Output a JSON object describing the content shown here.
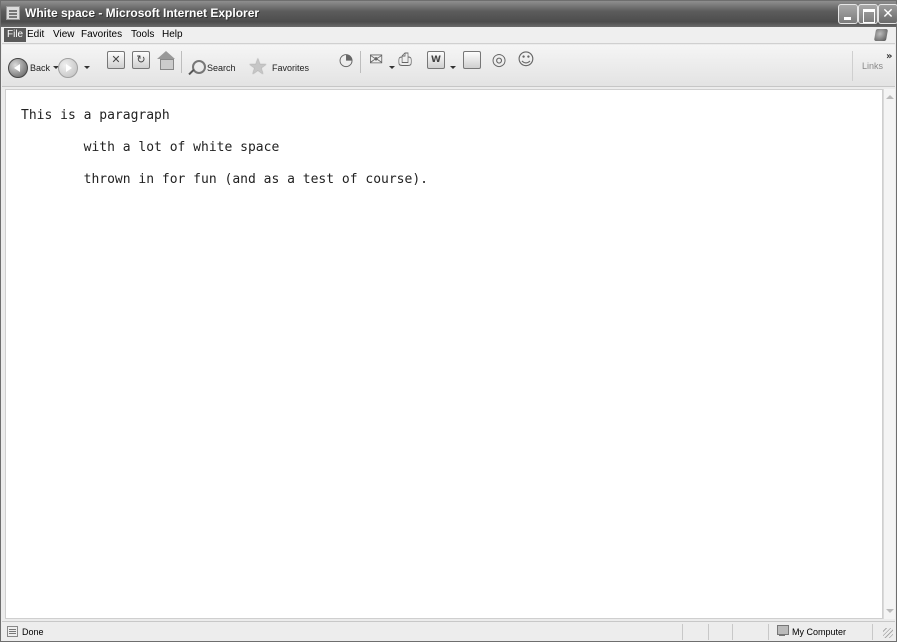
{
  "window": {
    "title": "White space - Microsoft Internet Explorer",
    "controls": {
      "close_glyph": "✕"
    }
  },
  "menubar": {
    "items": [
      "File",
      "Edit",
      "View",
      "Favorites",
      "Tools",
      "Help"
    ]
  },
  "toolbar": {
    "back_label": "Back",
    "search_label": "Search",
    "favorites_label": "Favorites",
    "links_label": "Links",
    "chevron": "»",
    "icons": {
      "back": "back-arrow-icon",
      "forward": "forward-arrow-icon",
      "stop": "stop-icon",
      "refresh": "refresh-icon",
      "home": "home-icon",
      "search": "search-icon",
      "favorites": "favorites-star-icon",
      "history": "history-icon",
      "mail": "mail-icon",
      "print": "print-icon",
      "edit": "edit-word-icon",
      "discuss": "discuss-icon",
      "research": "research-icon",
      "messenger": "messenger-icon"
    }
  },
  "content": {
    "lines": [
      "This is a paragraph",
      "        with a lot of white space",
      "        thrown in for fun (and as a test of course)."
    ]
  },
  "statusbar": {
    "status": "Done",
    "zone": "My Computer"
  }
}
